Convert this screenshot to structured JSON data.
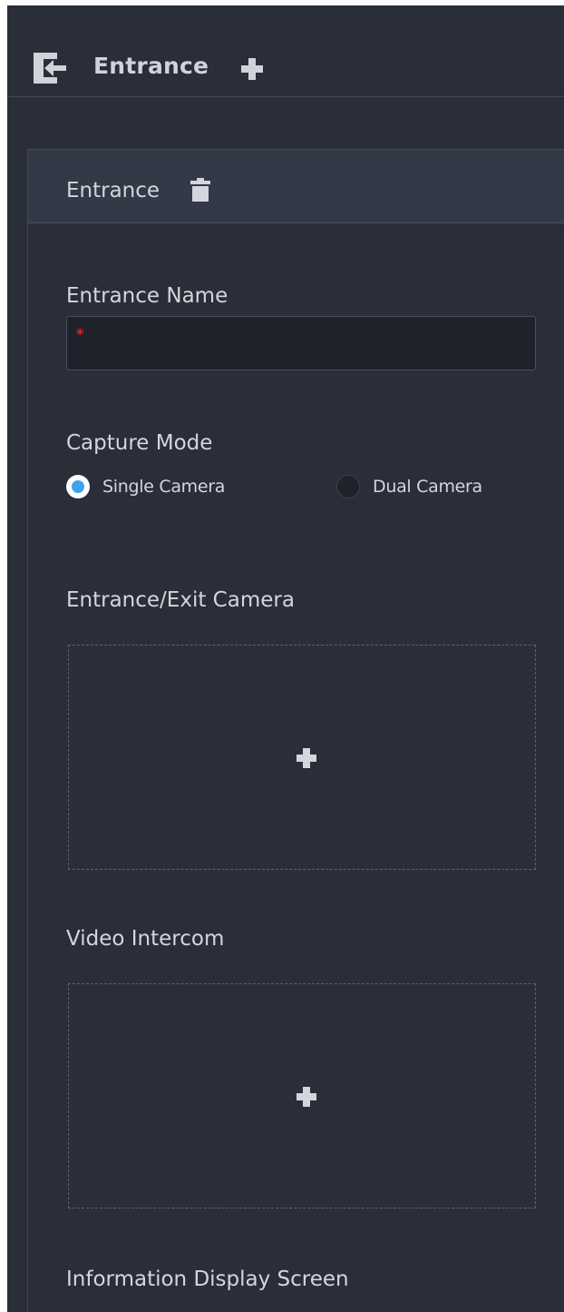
{
  "header": {
    "title": "Entrance",
    "icon": "entrance-icon",
    "add_icon": "plus-icon"
  },
  "panel": {
    "title": "Entrance",
    "delete_icon": "trash-icon",
    "entrance_name": {
      "label": "Entrance Name",
      "value": "",
      "required_marker": "*"
    },
    "capture_mode": {
      "label": "Capture Mode",
      "options": [
        "Single Camera",
        "Dual Camera"
      ],
      "selected": "Single Camera"
    },
    "entrance_exit_camera": {
      "label": "Entrance/Exit Camera",
      "add_icon": "plus-icon"
    },
    "video_intercom": {
      "label": "Video Intercom",
      "add_icon": "plus-icon"
    },
    "information_display_screen": {
      "label": "Information Display Screen"
    }
  },
  "colors": {
    "background": "#2a2e39",
    "panel_header": "#343947",
    "input_bg": "#1f222b",
    "text": "#d3d6dc",
    "accent": "#43a0ee",
    "required": "#e0252b"
  }
}
